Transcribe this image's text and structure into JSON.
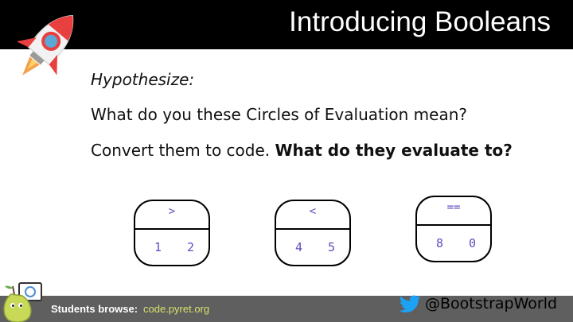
{
  "title": "Introducing Booleans",
  "content": {
    "hypothesize": "Hypothesize:",
    "question": "What do you these Circles of Evaluation mean?",
    "instruction_plain": "Convert them to code. ",
    "instruction_bold": "What do they evaluate to?"
  },
  "circles": [
    {
      "operator": ">",
      "left": "1",
      "right": "2"
    },
    {
      "operator": "<",
      "left": "4",
      "right": "5"
    },
    {
      "operator": "==",
      "left": "8",
      "right": "0"
    }
  ],
  "footer": {
    "label": "Students browse:",
    "link": "code.pyret.org",
    "handle": "@BootstrapWorld"
  },
  "colors": {
    "title_bar": "#000000",
    "code_text": "#5b4fbf",
    "footer_bg": "#5f5f5f",
    "footer_link": "#d8e06a",
    "twitter_blue": "#1da1f2"
  },
  "icons": {
    "rocket": "rocket-icon",
    "pear": "pear-mascot-icon",
    "twitter": "twitter-bird-icon"
  }
}
